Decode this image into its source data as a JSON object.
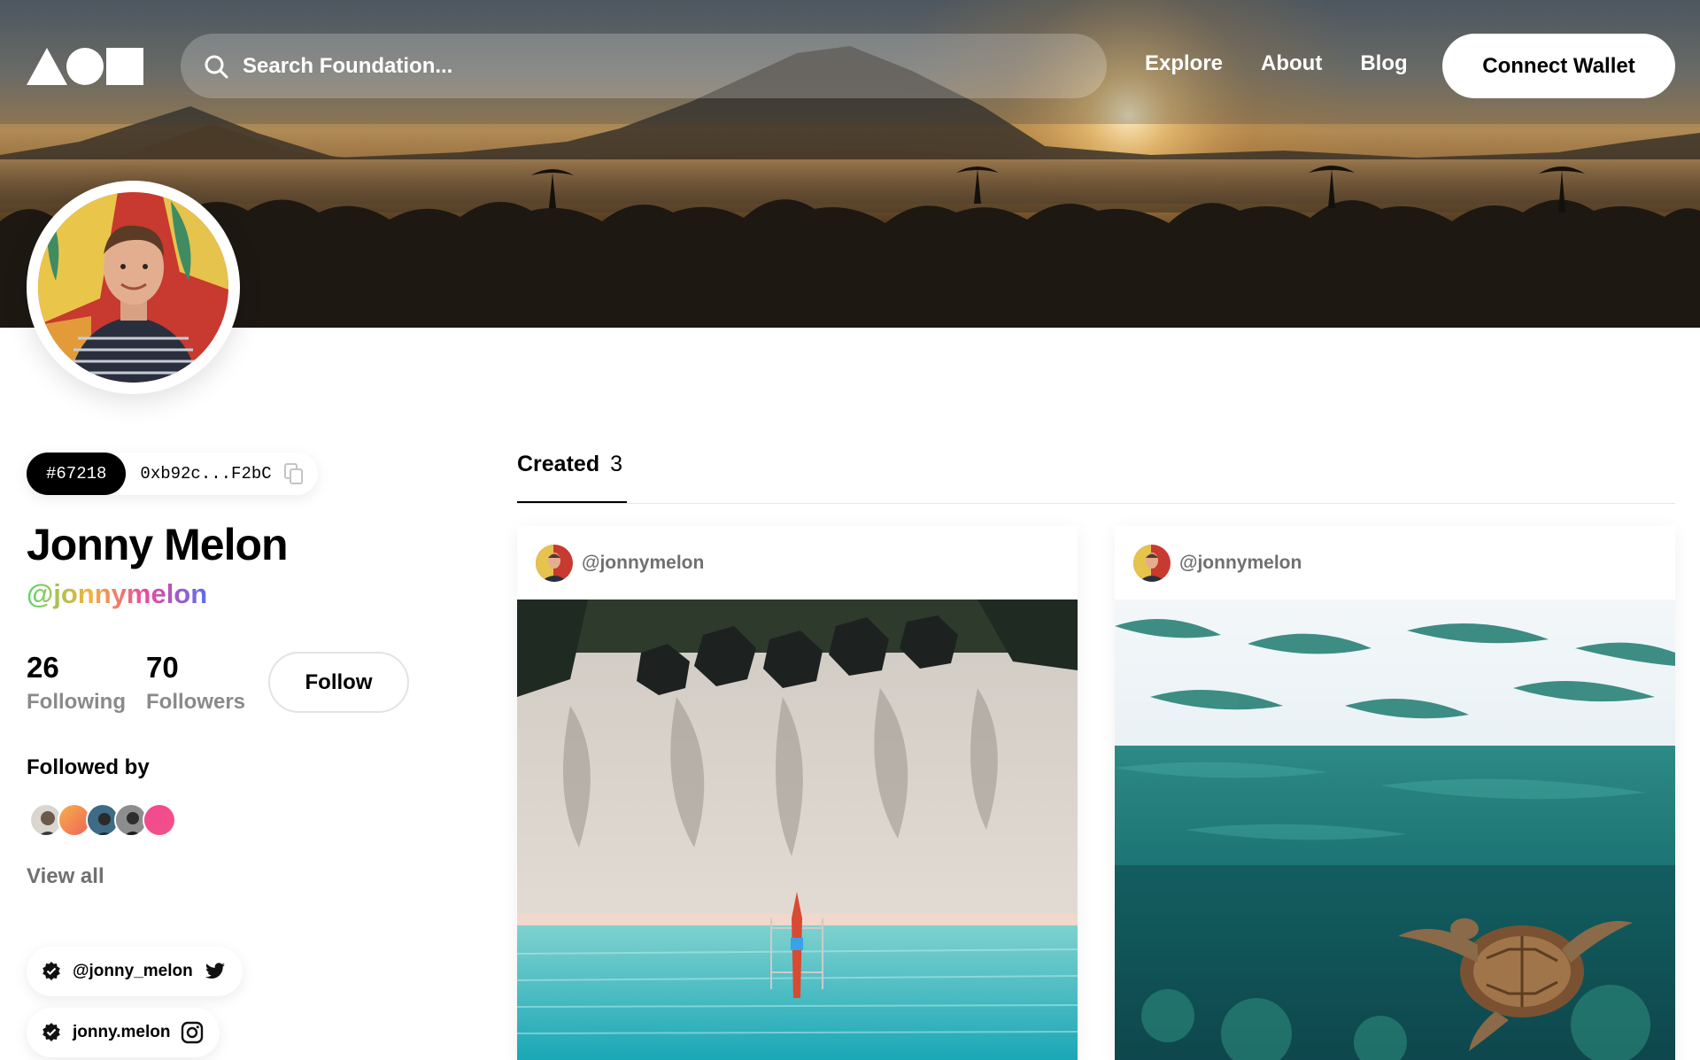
{
  "header": {
    "logo": "triangle-circle-square-logo",
    "search": {
      "placeholder": "Search Foundation..."
    },
    "nav": [
      {
        "label": "Explore"
      },
      {
        "label": "About"
      },
      {
        "label": "Blog"
      }
    ],
    "connect_label": "Connect Wallet"
  },
  "profile": {
    "id_badge": "#67218",
    "address": "0xb92c...F2bC",
    "name": "Jonny Melon",
    "handle": "@jonnymelon",
    "following_count": "26",
    "following_label": "Following",
    "followers_count": "70",
    "followers_label": "Followers",
    "follow_label": "Follow",
    "followed_by_title": "Followed by",
    "view_all_label": "View all",
    "socials": [
      {
        "label": "@jonny_melon",
        "icon": "twitter-icon"
      },
      {
        "label": "jonny.melon",
        "icon": "instagram-icon"
      }
    ],
    "handle_gradient": [
      "#5fd36b",
      "#f3b23a",
      "#ee4a9a",
      "#5a6cf2"
    ]
  },
  "tabs": [
    {
      "label": "Created",
      "count": "3"
    }
  ],
  "cards": [
    {
      "user": "@jonnymelon",
      "art": "aerial-beach-boat"
    },
    {
      "user": "@jonnymelon",
      "art": "sea-turtle-underwater"
    }
  ]
}
